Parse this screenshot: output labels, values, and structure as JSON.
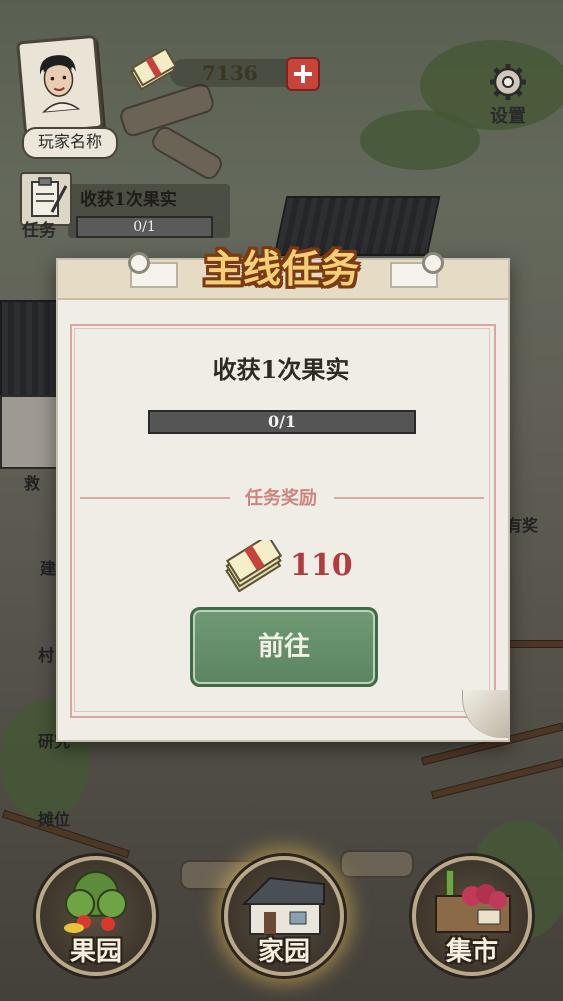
{
  "hud": {
    "player_name": "玩家名称",
    "money": "7136",
    "settings_label": "设置",
    "task_label": "任务",
    "task_title": "收获1次果实",
    "task_progress": "0/1"
  },
  "side_menu": [
    {
      "label": "救"
    },
    {
      "label": "建"
    },
    {
      "label": "村"
    },
    {
      "label": "研究"
    },
    {
      "label": "摊位"
    }
  ],
  "right_badge": "有奖",
  "modal": {
    "title": "主线任务",
    "task_name": "收获1次果实",
    "progress_text": "0/1",
    "progress_value": 0,
    "reward_title": "任务奖励",
    "reward_amount": "110",
    "go_button": "前往"
  },
  "bottom_nav": [
    {
      "label": "果园",
      "icon": "orchard-icon"
    },
    {
      "label": "家园",
      "icon": "house-icon",
      "active": true
    },
    {
      "label": "集市",
      "icon": "market-icon"
    }
  ],
  "colors": {
    "title_fill": "#f4cf77",
    "title_stroke": "#7c3a12",
    "reward_amount": "#b23b3b",
    "go_button": "#6f9a74"
  }
}
